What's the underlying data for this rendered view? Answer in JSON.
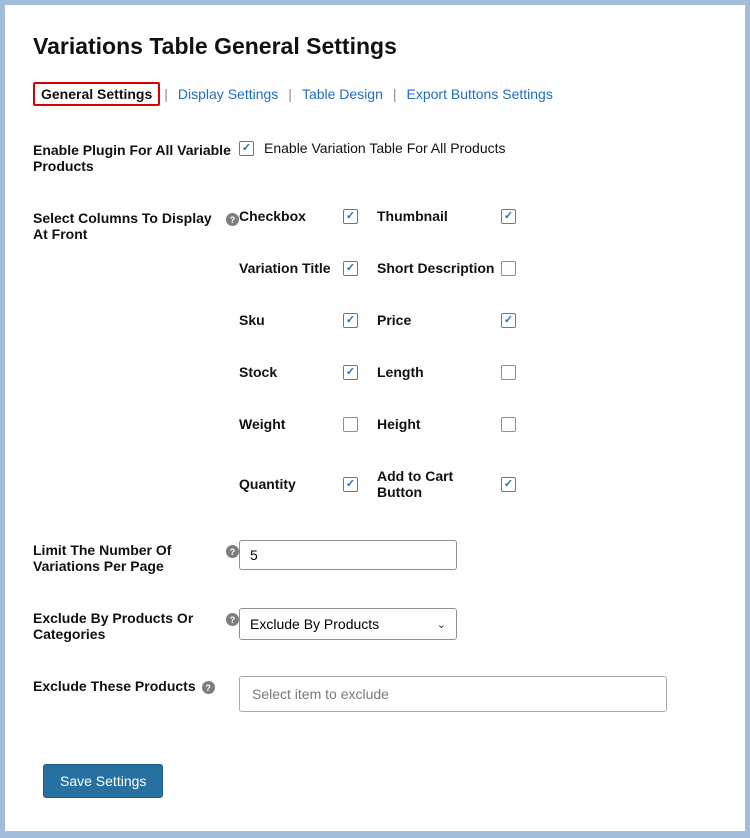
{
  "title": "Variations Table General Settings",
  "tabs": {
    "general": "General Settings",
    "display": "Display Settings",
    "design": "Table Design",
    "export": "Export Buttons Settings"
  },
  "labels": {
    "enable_all": "Enable Plugin For All Variable Products",
    "enable_all_checkbox": "Enable Variation Table For All Products",
    "select_columns": "Select Columns To Display At Front",
    "limit": "Limit The Number Of Variations Per Page",
    "exclude_by": "Exclude By Products Or Categories",
    "exclude_these": "Exclude These Products"
  },
  "columns": {
    "checkbox": "Checkbox",
    "thumbnail": "Thumbnail",
    "variation_title": "Variation Title",
    "short_desc": "Short Description",
    "sku": "Sku",
    "price": "Price",
    "stock": "Stock",
    "length": "Length",
    "weight": "Weight",
    "height": "Height",
    "quantity": "Quantity",
    "add_to_cart": "Add to Cart Button"
  },
  "values": {
    "limit": "5",
    "exclude_by": "Exclude By Products",
    "exclude_placeholder": "Select item to exclude"
  },
  "buttons": {
    "save": "Save Settings"
  }
}
